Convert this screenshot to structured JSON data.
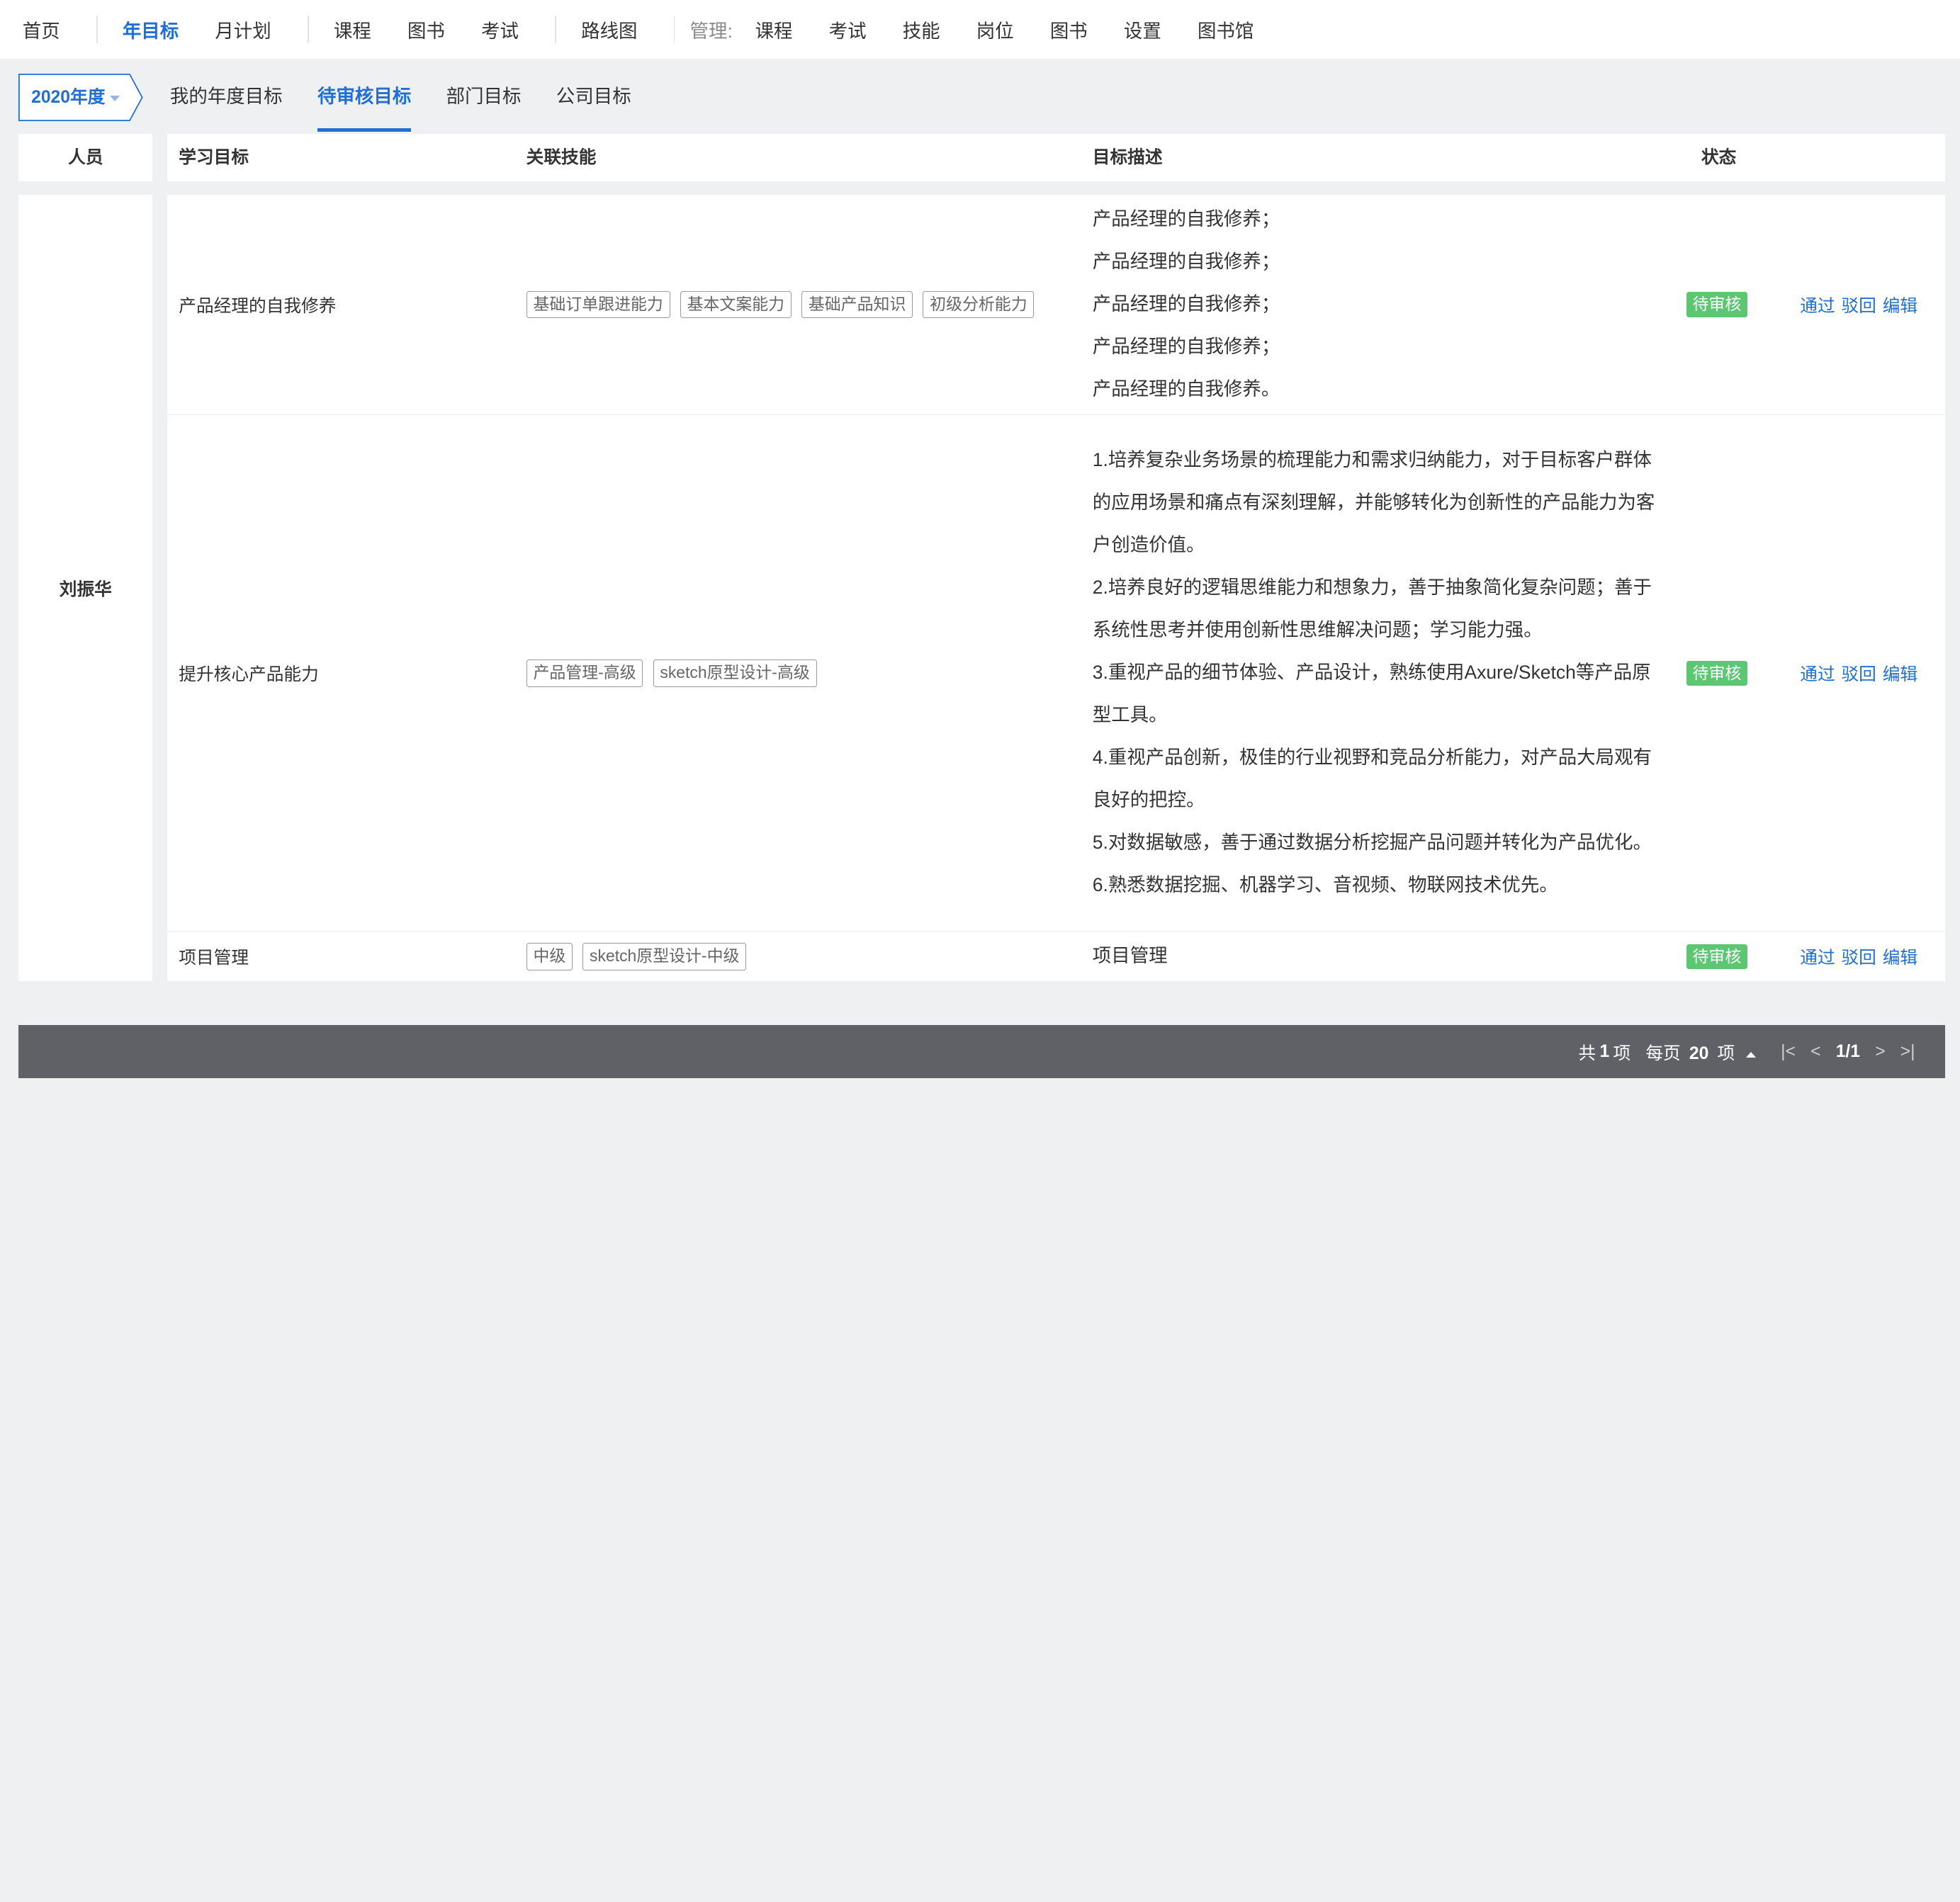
{
  "topnav": {
    "items": [
      "首页",
      "年目标",
      "月计划",
      "课程",
      "图书",
      "考试",
      "路线图"
    ],
    "mgr_label": "管理:",
    "mgr_items": [
      "课程",
      "考试",
      "技能",
      "岗位",
      "图书",
      "设置",
      "图书馆"
    ]
  },
  "subnav": {
    "year": "2020年度",
    "tabs": [
      "我的年度目标",
      "待审核目标",
      "部门目标",
      "公司目标"
    ]
  },
  "table": {
    "headers": {
      "person": "人员",
      "goal": "学习目标",
      "skills": "关联技能",
      "desc": "目标描述",
      "status": "状态"
    },
    "person": "刘振华",
    "rows": [
      {
        "goal": "产品经理的自我修养",
        "skills": [
          "基础订单跟进能力",
          "基本文案能力",
          "基础产品知识",
          "初级分析能力"
        ],
        "desc": [
          "产品经理的自我修养；",
          "产品经理的自我修养；",
          "产品经理的自我修养；",
          "产品经理的自我修养；",
          "产品经理的自我修养。"
        ],
        "status": "待审核",
        "actions": [
          "通过",
          "驳回",
          "编辑"
        ]
      },
      {
        "goal": "提升核心产品能力",
        "skills": [
          "产品管理-高级",
          "sketch原型设计-高级"
        ],
        "desc": [
          "1.培养复杂业务场景的梳理能力和需求归纳能力，对于目标客户群体的应用场景和痛点有深刻理解，并能够转化为创新性的产品能力为客户创造价值。",
          "2.培养良好的逻辑思维能力和想象力，善于抽象简化复杂问题；善于系统性思考并使用创新性思维解决问题；学习能力强。",
          "3.重视产品的细节体验、产品设计，熟练使用Axure/Sketch等产品原型工具。",
          "4.重视产品创新，极佳的行业视野和竞品分析能力，对产品大局观有良好的把控。",
          "5.对数据敏感，善于通过数据分析挖掘产品问题并转化为产品优化。",
          "6.熟悉数据挖掘、机器学习、音视频、物联网技术优先。"
        ],
        "status": "待审核",
        "actions": [
          "通过",
          "驳回",
          "编辑"
        ]
      },
      {
        "goal": "项目管理",
        "skills": [
          "中级",
          "sketch原型设计-中级"
        ],
        "desc": [
          "项目管理"
        ],
        "status": "待审核",
        "actions": [
          "通过",
          "驳回",
          "编辑"
        ]
      }
    ]
  },
  "footer": {
    "total_prefix": "共",
    "total": "1",
    "total_suffix": "项",
    "per_page_prefix": "每页",
    "per_page": "20",
    "per_page_suffix": "项",
    "page": "1/1"
  },
  "colors": {
    "accent": "#1f6fd4",
    "status_pending": "#5cc672",
    "footer_bg": "#5f6166"
  }
}
